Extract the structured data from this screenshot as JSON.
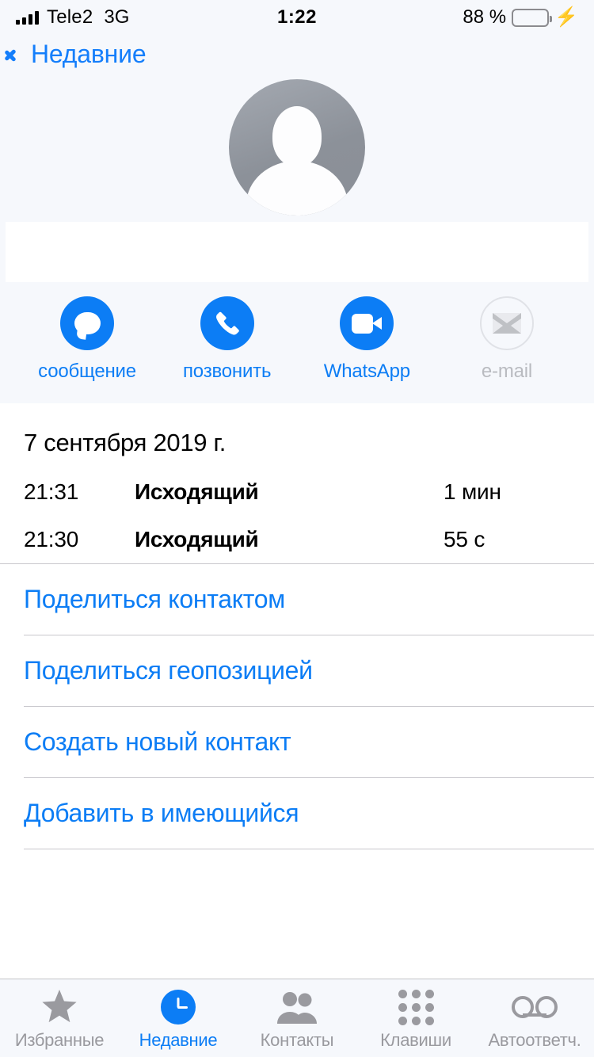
{
  "status_bar": {
    "carrier": "Tele2",
    "network": "3G",
    "time": "1:22",
    "battery_percent": "88 %",
    "charging_icon": "lightning-bolt-icon",
    "signal_icon": "signal-bars-icon",
    "battery_fill_color": "#4CD55F"
  },
  "nav": {
    "back_label": "Недавние",
    "back_icon": "chevron-left-icon"
  },
  "contact": {
    "avatar_icon": "person-placeholder-avatar",
    "name": ""
  },
  "actions": [
    {
      "label": "сообщение",
      "icon": "message-bubble-icon",
      "enabled": true
    },
    {
      "label": "позвонить",
      "icon": "phone-handset-icon",
      "enabled": true
    },
    {
      "label": "WhatsApp",
      "icon": "video-camera-icon",
      "enabled": true
    },
    {
      "label": "e-mail",
      "icon": "envelope-icon",
      "enabled": false
    }
  ],
  "history": {
    "date": "7 сентября 2019 г.",
    "calls": [
      {
        "time": "21:31",
        "type": "Исходящий",
        "duration": "1 мин"
      },
      {
        "time": "21:30",
        "type": "Исходящий",
        "duration": "55 с"
      }
    ]
  },
  "links": [
    {
      "label": "Поделиться контактом"
    },
    {
      "label": "Поделиться геопозицией"
    },
    {
      "label": "Создать новый контакт"
    },
    {
      "label": "Добавить в имеющийся"
    }
  ],
  "tabs": [
    {
      "label": "Избранные",
      "icon": "star-icon",
      "active": false
    },
    {
      "label": "Недавние",
      "icon": "clock-icon",
      "active": true
    },
    {
      "label": "Контакты",
      "icon": "people-icon",
      "active": false
    },
    {
      "label": "Клавиши",
      "icon": "keypad-icon",
      "active": false
    },
    {
      "label": "Автоответч.",
      "icon": "voicemail-icon",
      "active": false
    }
  ],
  "colors": {
    "accent_blue": "#0C7DF5",
    "nav_blue": "#147EFB",
    "tint_background": "#F6F8FC",
    "inactive_gray": "#9A9A9F",
    "separator": "#C8C7CC"
  }
}
